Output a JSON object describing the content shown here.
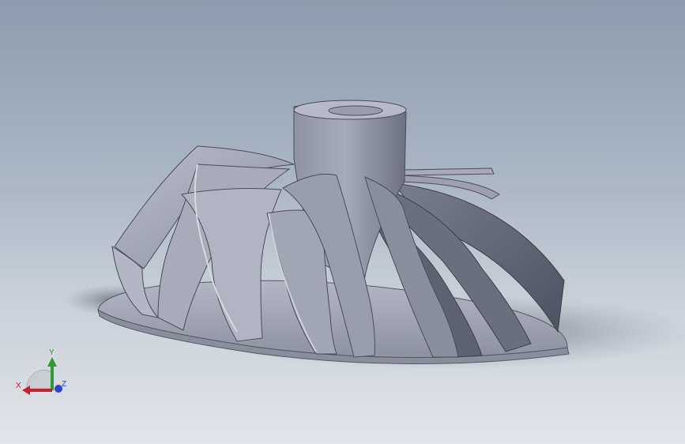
{
  "viewport": {
    "background_top": "#8e9cad",
    "background_bottom": "#e2e5e9",
    "model": {
      "name": "compressor-impeller",
      "body_color": "#9a9daa",
      "shadow_color": "#c7ccd3"
    }
  },
  "triad": {
    "x_label": "X",
    "y_label": "Y",
    "z_label": "Z",
    "x_color": "#c8202a",
    "y_color": "#2e9b31",
    "z_color": "#2b45c8"
  }
}
